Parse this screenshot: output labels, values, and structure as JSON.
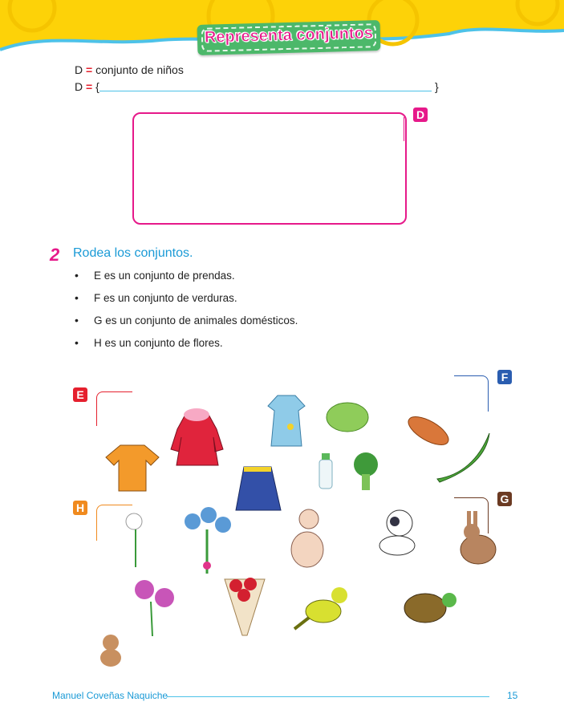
{
  "header": {
    "title": "Representa conjuntos"
  },
  "set_d": {
    "definition_label": "D",
    "equals": "=",
    "definition_text": "conjunto de niños",
    "brace_open": "{",
    "brace_close": "}",
    "tag": "D"
  },
  "exercise": {
    "number": "2",
    "title": "Rodea los conjuntos.",
    "bullet": "•",
    "items": [
      "E es un conjunto de prendas.",
      "F es un conjunto de verduras.",
      "G es un conjunto de animales domésticos.",
      "H es un conjunto de flores."
    ]
  },
  "set_tags": {
    "E": "E",
    "F": "F",
    "G": "G",
    "H": "H"
  },
  "colors": {
    "pink": "#e6198a",
    "blue": "#1a9ad6",
    "green": "#4cb86a",
    "yellow": "#fdd208",
    "tagE": "#e5202e",
    "tagF": "#2a5db0",
    "tagG": "#6b3a22",
    "tagH": "#f08a1e"
  },
  "footer": {
    "author": "Manuel Coveñas Naquiche",
    "page_number": "15"
  }
}
